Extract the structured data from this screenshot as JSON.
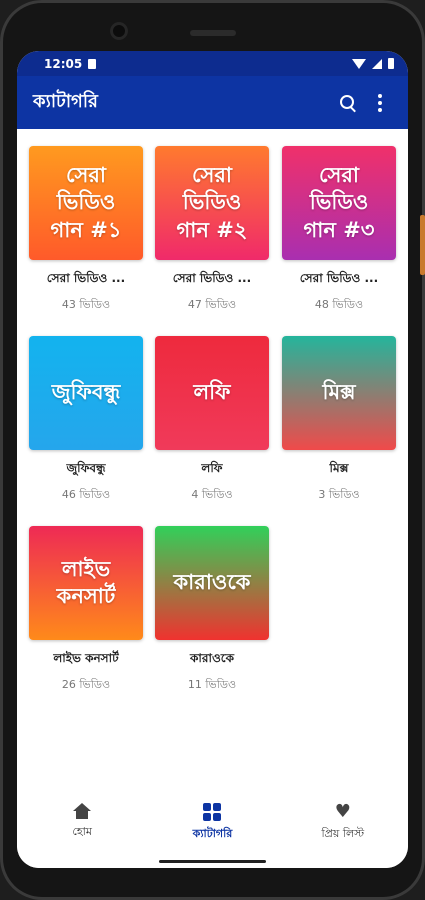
{
  "status": {
    "time": "12:05"
  },
  "appbar": {
    "title": "ক্যাটাগরি"
  },
  "categories": [
    {
      "thumb_text": "সেরা\nভিডিও\nগান #১",
      "title": "সেরা ভিডিও ...",
      "count": "43 ভিডিও",
      "colors": [
        "#ff9a1f",
        "#ff5a2a"
      ]
    },
    {
      "thumb_text": "সেরা\nভিডিও\nগান #২",
      "title": "সেরা ভিডিও ...",
      "count": "47 ভিডিও",
      "colors": [
        "#ff7a2e",
        "#f02a6a"
      ]
    },
    {
      "thumb_text": "সেরা\nভিডিও\nগান #৩",
      "title": "সেরা ভিডিও ...",
      "count": "48 ভিডিও",
      "colors": [
        "#f0306a",
        "#a92fb0"
      ]
    },
    {
      "thumb_text": "জুফিবন্ধু",
      "title": "জুফিবন্ধু",
      "count": "46 ভিডিও",
      "colors": [
        "#13b3ee",
        "#25a6ec"
      ]
    },
    {
      "thumb_text": "লফি",
      "title": "লফি",
      "count": "4 ভিডিও",
      "colors": [
        "#ee2a3d",
        "#f03a5a"
      ]
    },
    {
      "thumb_text": "মিক্স",
      "title": "মিক্স",
      "count": "3 ভিডিও",
      "colors": [
        "#24b59c",
        "#f04a4a"
      ]
    },
    {
      "thumb_text": "লাইভ\nকনসার্ট",
      "title": "লাইভ কনসার্ট",
      "count": "26 ভিডিও",
      "colors": [
        "#ee2a55",
        "#ff8a1a"
      ]
    },
    {
      "thumb_text": "কারাওকে",
      "title": "কারাওকে",
      "count": "11 ভিডিও",
      "colors": [
        "#31d05a",
        "#f0322f"
      ]
    }
  ],
  "nav": {
    "home": "হোম",
    "category": "ক্যাটাগরি",
    "favorites": "প্রিয় লিস্ট"
  }
}
